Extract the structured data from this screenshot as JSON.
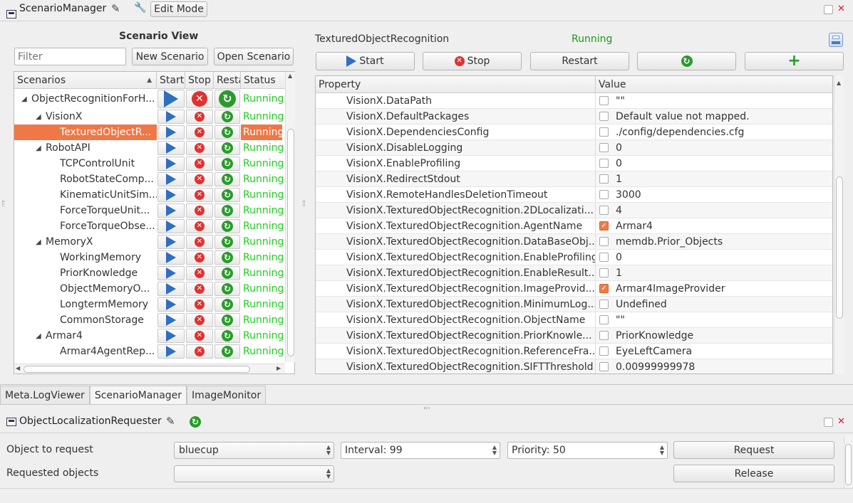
{
  "top_window": {
    "title": "ScenarioManager",
    "edit_mode_label": "Edit Mode"
  },
  "scenario_view": {
    "heading": "Scenario View",
    "filter_placeholder": "Filter",
    "new_scenario_label": "New Scenario",
    "open_scenario_label": "Open Scenario",
    "columns": [
      "Scenarios",
      "Start",
      "Stop",
      "Resta",
      "Status"
    ],
    "items": [
      {
        "label": "ObjectRecognitionForH...",
        "status": "Running",
        "level": 0,
        "expanded": true,
        "big": true
      },
      {
        "label": "VisionX",
        "status": "Running",
        "level": 1,
        "expanded": true
      },
      {
        "label": "TexturedObjectR...",
        "status": "Running",
        "level": 2,
        "selected": true
      },
      {
        "label": "RobotAPI",
        "status": "Running",
        "level": 1,
        "expanded": true
      },
      {
        "label": "TCPControlUnit",
        "status": "Running",
        "level": 2
      },
      {
        "label": "RobotStateComp...",
        "status": "Running",
        "level": 2
      },
      {
        "label": "KinematicUnitSim...",
        "status": "Running",
        "level": 2
      },
      {
        "label": "ForceTorqueUnit...",
        "status": "Running",
        "level": 2
      },
      {
        "label": "ForceTorqueObse...",
        "status": "Running",
        "level": 2
      },
      {
        "label": "MemoryX",
        "status": "Running",
        "level": 1,
        "expanded": true
      },
      {
        "label": "WorkingMemory",
        "status": "Running",
        "level": 2
      },
      {
        "label": "PriorKnowledge",
        "status": "Running",
        "level": 2
      },
      {
        "label": "ObjectMemoryO...",
        "status": "Running",
        "level": 2
      },
      {
        "label": "LongtermMemory",
        "status": "Running",
        "level": 2
      },
      {
        "label": "CommonStorage",
        "status": "Running",
        "level": 2
      },
      {
        "label": "Armar4",
        "status": "Running",
        "level": 1,
        "expanded": true
      },
      {
        "label": "Armar4AgentRep...",
        "status": "Running",
        "level": 2
      }
    ]
  },
  "detail": {
    "app_name": "TexturedObjectRecognition",
    "status": "Running",
    "start_label": "Start",
    "stop_label": "Stop",
    "restart_label": "Restart",
    "columns": [
      "Property",
      "Value"
    ],
    "properties": [
      {
        "name": "VisionX.DataPath",
        "value": "\"\"",
        "checked": false
      },
      {
        "name": "VisionX.DefaultPackages",
        "value": "Default value not mapped.",
        "checked": false
      },
      {
        "name": "VisionX.DependenciesConfig",
        "value": "./config/dependencies.cfg",
        "checked": false
      },
      {
        "name": "VisionX.DisableLogging",
        "value": "0",
        "checked": false
      },
      {
        "name": "VisionX.EnableProfiling",
        "value": "0",
        "checked": false
      },
      {
        "name": "VisionX.RedirectStdout",
        "value": "1",
        "checked": false
      },
      {
        "name": "VisionX.RemoteHandlesDeletionTimeout",
        "value": "3000",
        "checked": false
      },
      {
        "name": "VisionX.TexturedObjectRecognition.2DLocalizati...",
        "value": "4",
        "checked": false
      },
      {
        "name": "VisionX.TexturedObjectRecognition.AgentName",
        "value": "Armar4",
        "checked": true
      },
      {
        "name": "VisionX.TexturedObjectRecognition.DataBaseObj...",
        "value": "memdb.Prior_Objects",
        "checked": false
      },
      {
        "name": "VisionX.TexturedObjectRecognition.EnableProfiling",
        "value": "0",
        "checked": false
      },
      {
        "name": "VisionX.TexturedObjectRecognition.EnableResult...",
        "value": "1",
        "checked": false
      },
      {
        "name": "VisionX.TexturedObjectRecognition.ImageProvid...",
        "value": "Armar4ImageProvider",
        "checked": true
      },
      {
        "name": "VisionX.TexturedObjectRecognition.MinimumLog...",
        "value": "Undefined",
        "checked": false
      },
      {
        "name": "VisionX.TexturedObjectRecognition.ObjectName",
        "value": "\"\"",
        "checked": false
      },
      {
        "name": "VisionX.TexturedObjectRecognition.PriorKnowle...",
        "value": "PriorKnowledge",
        "checked": false
      },
      {
        "name": "VisionX.TexturedObjectRecognition.ReferenceFra...",
        "value": "EyeLeftCamera",
        "checked": false
      },
      {
        "name": "VisionX.TexturedObjectRecognition.SIFTThreshold",
        "value": "0.00999999978",
        "checked": false
      }
    ]
  },
  "tabs": [
    "Meta.LogViewer",
    "ScenarioManager",
    "ImageMonitor"
  ],
  "bottom_window": {
    "title": "ObjectLocalizationRequester",
    "object_label": "Object to request",
    "object_value": "bluecup",
    "interval_value": "Interval: 99",
    "priority_value": "Priority: 50",
    "request_label": "Request",
    "requested_label": "Requested objects",
    "requested_value": "",
    "release_label": "Release"
  },
  "colors": {
    "selection": "#f07746",
    "running": "#22cc22",
    "status_running_header": "#1a9a1a"
  }
}
